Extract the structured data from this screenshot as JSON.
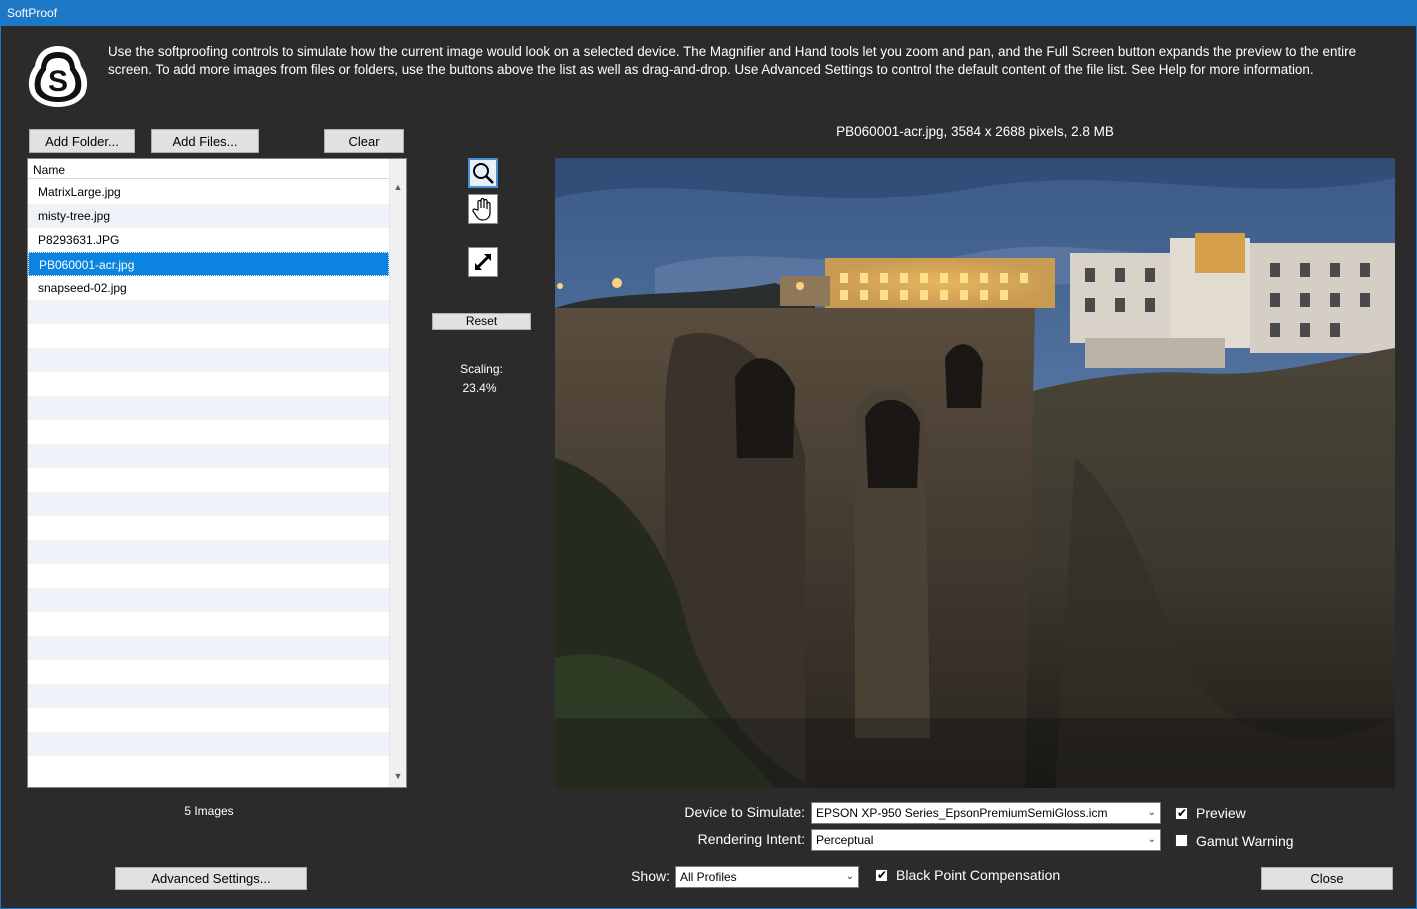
{
  "window": {
    "title": "SoftProof"
  },
  "intro_text": "Use the softproofing controls to simulate how the current image would look on a selected device. The Magnifier and Hand tools let you zoom and pan, and the Full Screen button expands the preview to the entire screen. To add more images from files or folders, use the buttons above the list as well as drag-and-drop. Use Advanced Settings to control the default content of the file list. See Help for more information.",
  "toolbar": {
    "add_folder": "Add Folder...",
    "add_files": "Add Files...",
    "clear": "Clear"
  },
  "file_list": {
    "column_header": "Name",
    "items": [
      "MatrixLarge.jpg",
      "misty-tree.jpg",
      "P8293631.JPG",
      "PB060001-acr.jpg",
      "snapseed-02.jpg"
    ],
    "selected_index": 3,
    "count_label": "5 Images"
  },
  "advanced_settings": "Advanced Settings...",
  "tools": {
    "magnifier_icon": "magnifier-icon",
    "hand_icon": "hand-icon",
    "fullscreen_icon": "fullscreen-icon",
    "reset": "Reset",
    "scaling_label": "Scaling:",
    "scaling_value": "23.4%"
  },
  "image_info": "PB060001-acr.jpg, 3584 x 2688 pixels, 2.8 MB",
  "controls": {
    "device_label": "Device to Simulate:",
    "device_value": "EPSON XP-950 Series_EpsonPremiumSemiGloss.icm",
    "intent_label": "Rendering Intent:",
    "intent_value": "Perceptual",
    "show_label": "Show:",
    "show_value": "All Profiles",
    "preview_label": "Preview",
    "preview_checked": true,
    "gamut_label": "Gamut Warning",
    "gamut_checked": false,
    "bpc_label": "Black Point Compensation",
    "bpc_checked": true,
    "close": "Close"
  },
  "colors": {
    "titlebar": "#1e78c8",
    "background": "#2b2b2b",
    "selection": "#0a84e0"
  }
}
